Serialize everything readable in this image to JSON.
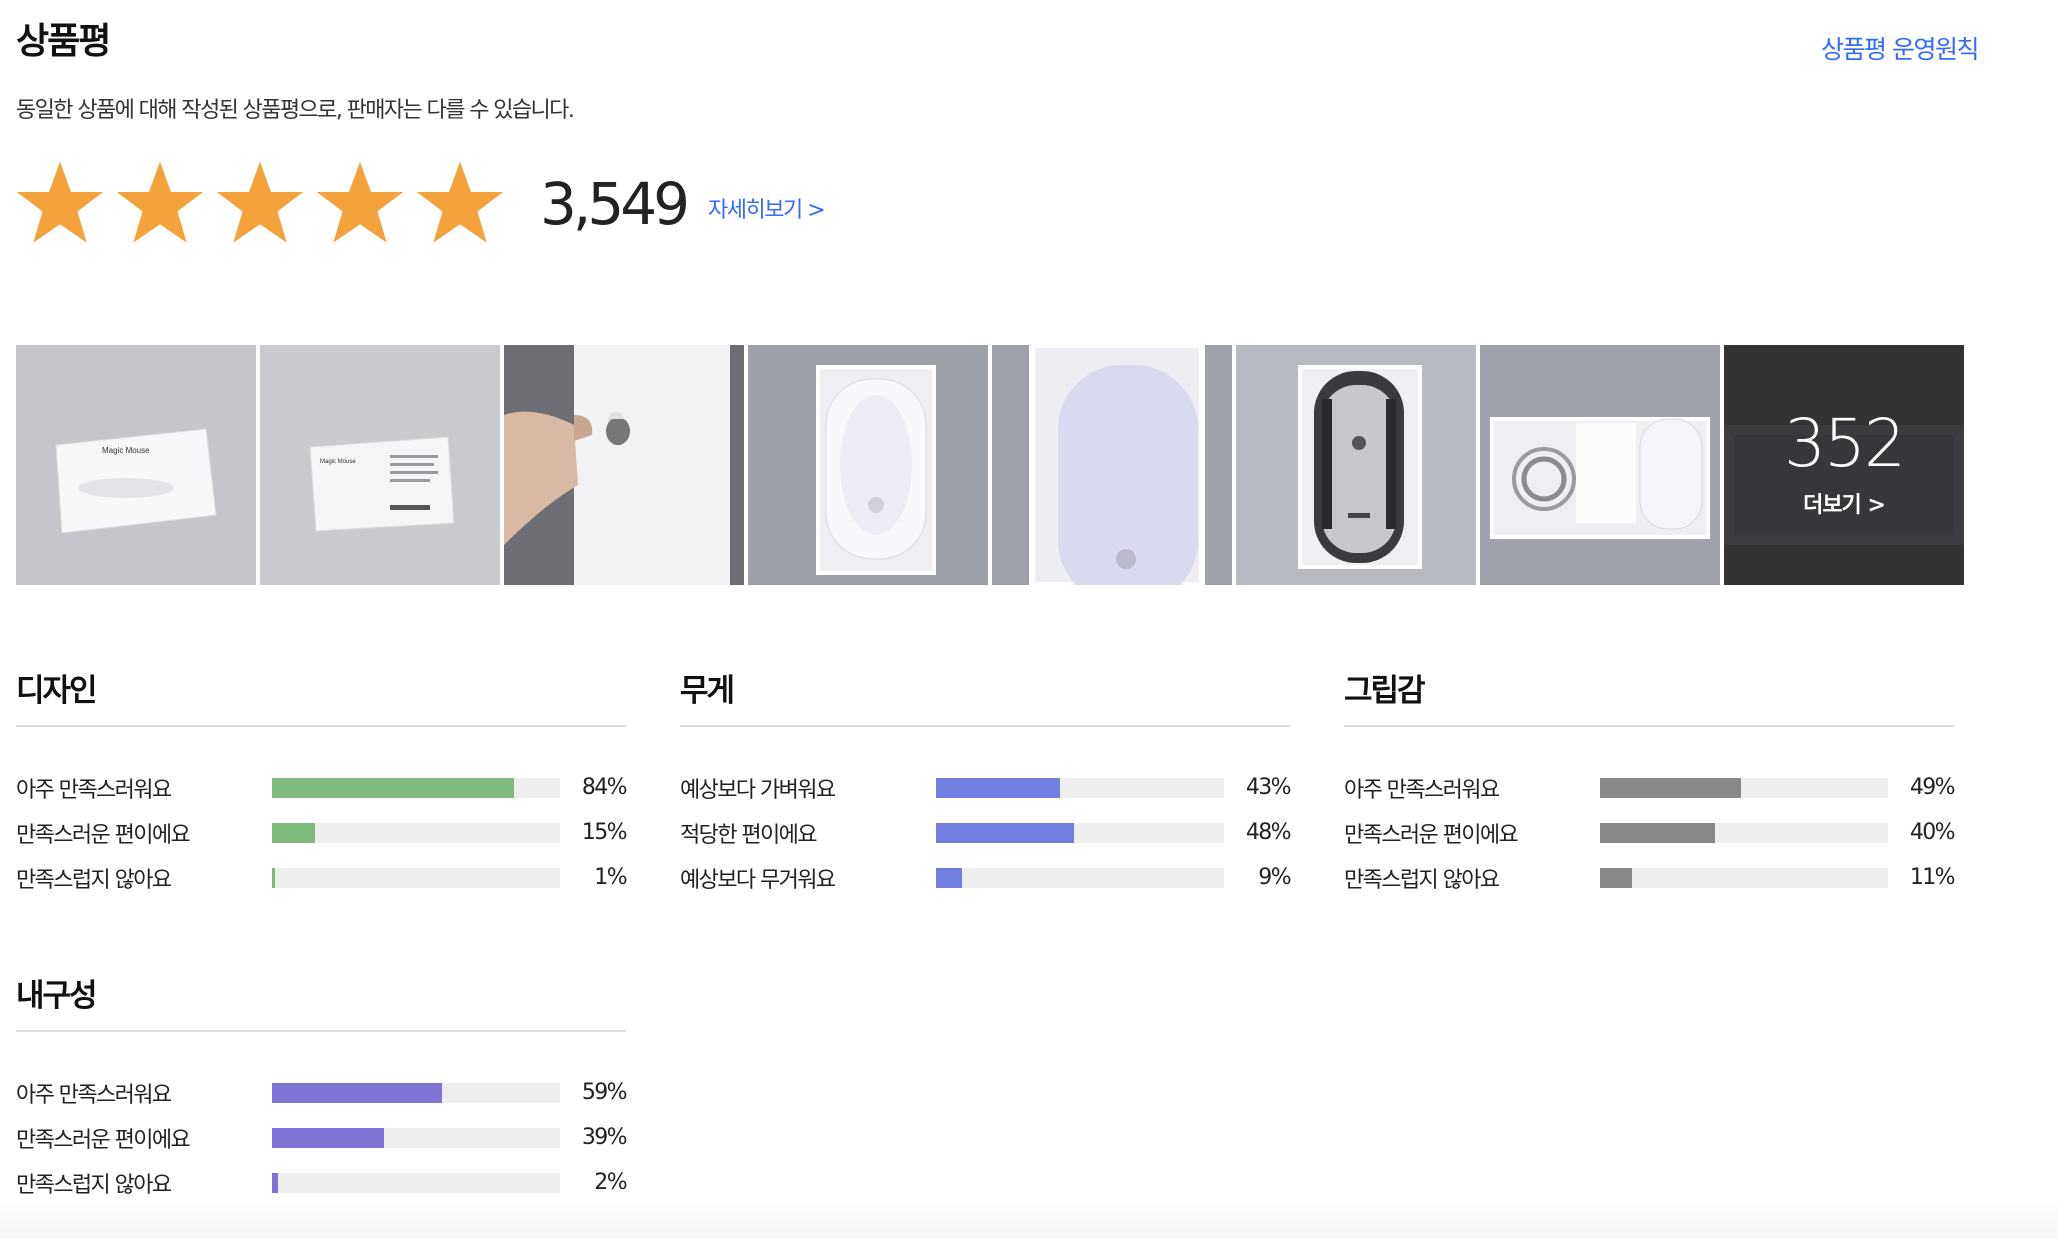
{
  "header": {
    "title": "상품평",
    "policy_link": "상품평 운영원칙",
    "subtitle": "동일한 상품에 대해 작성된 상품평으로, 판매자는 다를 수 있습니다."
  },
  "rating": {
    "stars_filled": 5,
    "stars_total": 5,
    "count": "3,549",
    "detail_link": "자세히보기 >",
    "star_color": "#f4a23b"
  },
  "photos": {
    "items": [
      {
        "name": "magic-mouse-box-front",
        "caption": "Magic Mouse"
      },
      {
        "name": "magic-mouse-box-back",
        "caption": "Magic Mouse"
      },
      {
        "name": "box-side-in-hand"
      },
      {
        "name": "mouse-in-tray-top"
      },
      {
        "name": "mouse-in-tray-closeup"
      },
      {
        "name": "mouse-underside"
      },
      {
        "name": "box-contents-cable"
      }
    ],
    "more_count": "352",
    "more_label": "더보기 >"
  },
  "surveys": [
    {
      "title": "디자인",
      "color": "#7dba7c",
      "rows": [
        {
          "label": "아주 만족스러워요",
          "pct": 84,
          "pct_text": "84%"
        },
        {
          "label": "만족스러운 편이에요",
          "pct": 15,
          "pct_text": "15%"
        },
        {
          "label": "만족스럽지 않아요",
          "pct": 1,
          "pct_text": "1%"
        }
      ]
    },
    {
      "title": "무게",
      "color": "#6f7edf",
      "rows": [
        {
          "label": "예상보다 가벼워요",
          "pct": 43,
          "pct_text": "43%"
        },
        {
          "label": "적당한 편이에요",
          "pct": 48,
          "pct_text": "48%"
        },
        {
          "label": "예상보다 무거워요",
          "pct": 9,
          "pct_text": "9%"
        }
      ]
    },
    {
      "title": "그립감",
      "color": "#888888",
      "rows": [
        {
          "label": "아주 만족스러워요",
          "pct": 49,
          "pct_text": "49%"
        },
        {
          "label": "만족스러운 편이에요",
          "pct": 40,
          "pct_text": "40%"
        },
        {
          "label": "만족스럽지 않아요",
          "pct": 11,
          "pct_text": "11%"
        }
      ]
    },
    {
      "title": "내구성",
      "color": "#8073d6",
      "rows": [
        {
          "label": "아주 만족스러워요",
          "pct": 59,
          "pct_text": "59%"
        },
        {
          "label": "만족스러운 편이에요",
          "pct": 39,
          "pct_text": "39%"
        },
        {
          "label": "만족스럽지 않아요",
          "pct": 2,
          "pct_text": "2%"
        }
      ]
    }
  ]
}
